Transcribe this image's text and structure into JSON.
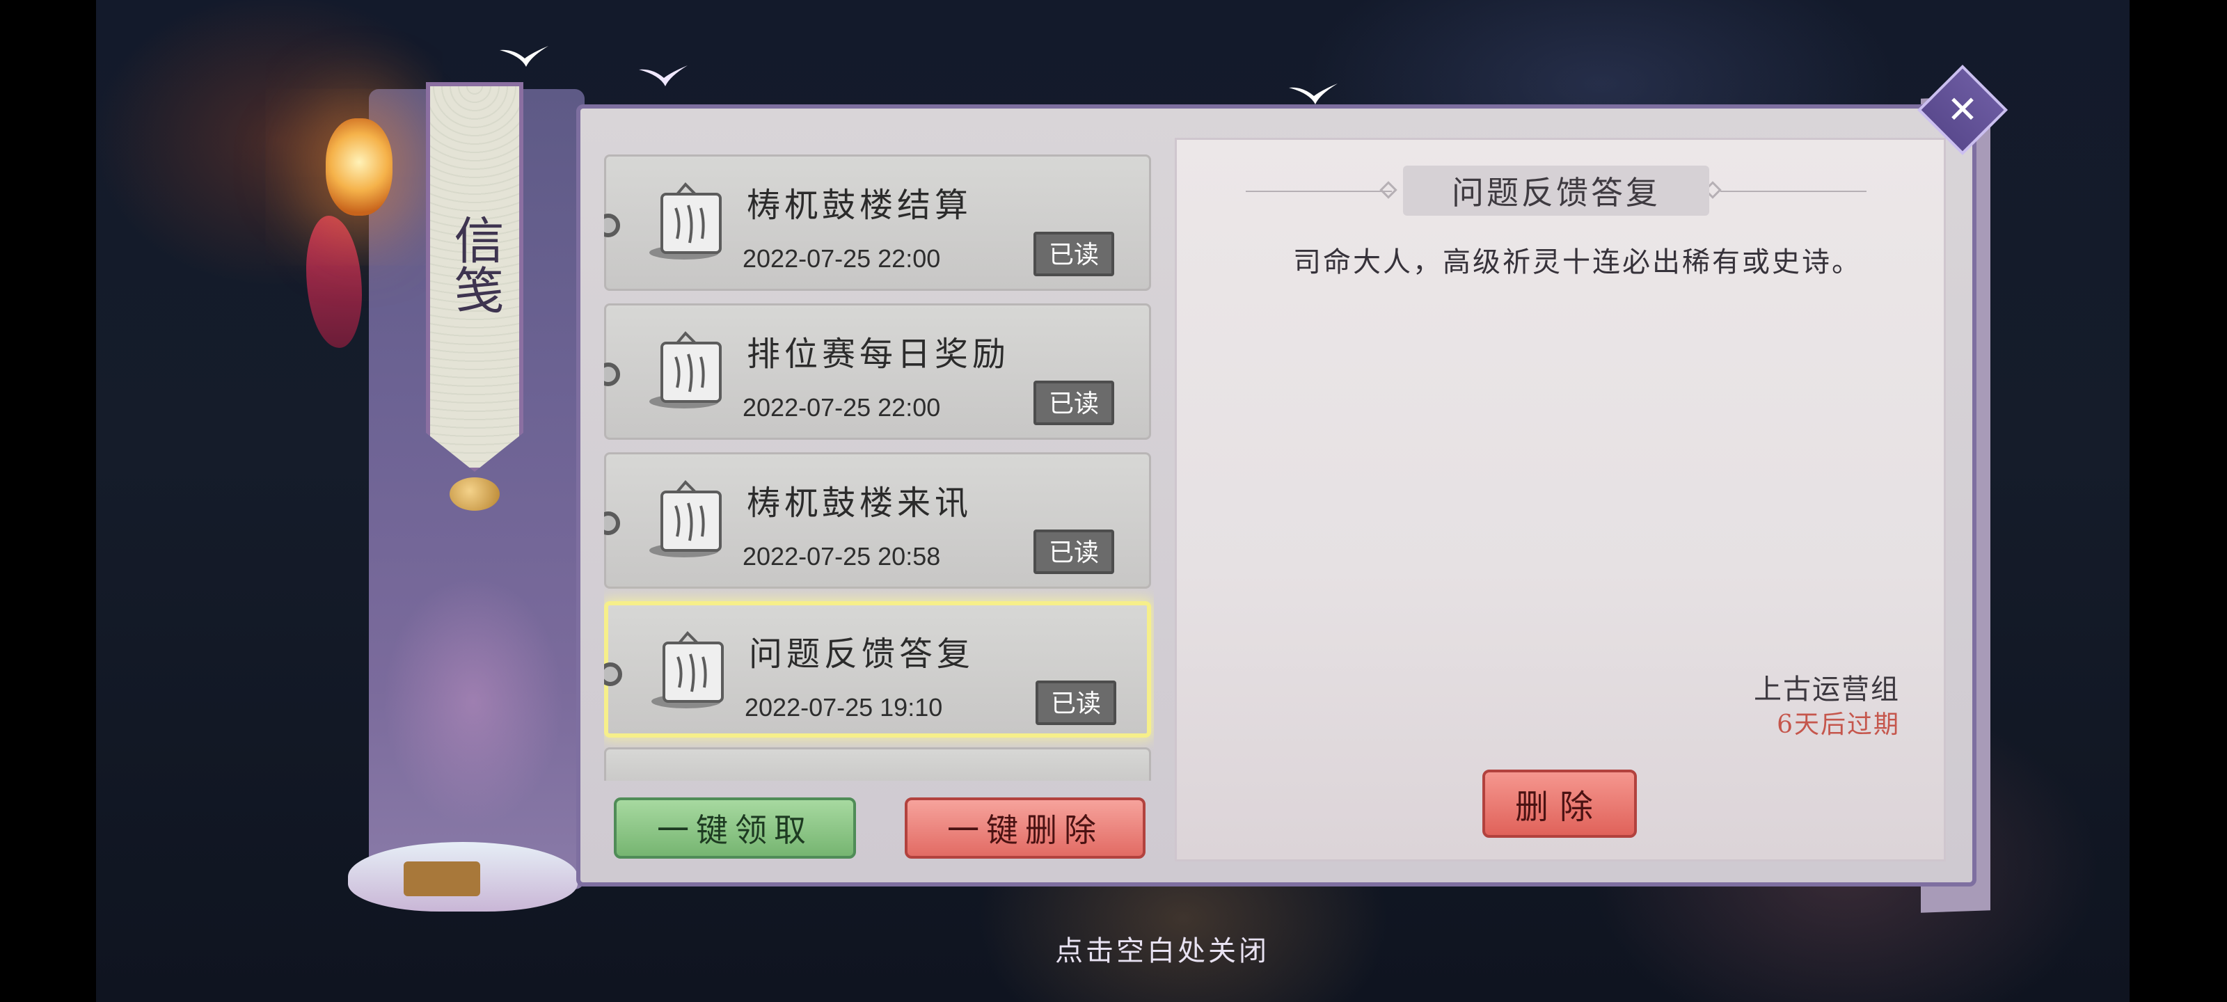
{
  "side_banner": {
    "title": "信笺"
  },
  "mail_list": {
    "items": [
      {
        "title": "梼杌鼓楼结算",
        "date": "2022-07-25  22:00",
        "status": "已读",
        "selected": false
      },
      {
        "title": "排位赛每日奖励",
        "date": "2022-07-25  22:00",
        "status": "已读",
        "selected": false
      },
      {
        "title": "梼杌鼓楼来讯",
        "date": "2022-07-25  20:58",
        "status": "已读",
        "selected": false
      },
      {
        "title": "问题反馈答复",
        "date": "2022-07-25  19:10",
        "status": "已读",
        "selected": true
      }
    ]
  },
  "actions": {
    "claim_all": "一键领取",
    "delete_all": "一键删除"
  },
  "detail": {
    "title": "问题反馈答复",
    "body": "司命大人，高级祈灵十连必出稀有或史诗。",
    "sender": "上古运营组",
    "expire": "6天后过期",
    "delete_label": "删除"
  },
  "close_hint": "点击空白处关闭",
  "icons": {
    "close": "close-x-icon",
    "mail": "letter-scroll-icon"
  },
  "colors": {
    "accent": "#7e6fa0",
    "claim": "#76b571",
    "delete": "#e26b64",
    "expire": "#c5564c",
    "selected_glow": "#f6ef8a"
  }
}
